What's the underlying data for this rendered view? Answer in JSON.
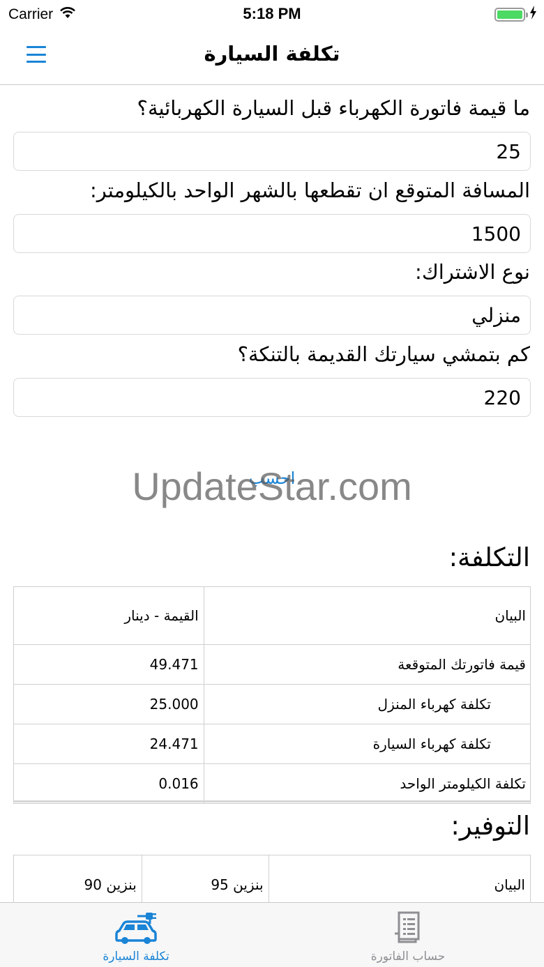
{
  "status_bar": {
    "carrier": "Carrier",
    "time": "5:18 PM",
    "battery_level": 1.0
  },
  "nav": {
    "title": "تكلفة السيارة",
    "menu_icon": "hamburger-menu-icon"
  },
  "form": {
    "q1": {
      "label": "ما قيمة فاتورة الكهرباء قبل السيارة الكهربائية؟",
      "value": "25"
    },
    "q2": {
      "label": "المسافة المتوقع ان تقطعها بالشهر الواحد بالكيلومتر:",
      "value": "1500"
    },
    "q3": {
      "label": "نوع الاشتراك:",
      "value": "منزلي"
    },
    "q4": {
      "label": "كم بتمشي سيارتك القديمة بالتنكة؟",
      "value": "220"
    },
    "calculate_label": "احسب"
  },
  "watermark": "UpdateStar.com",
  "cost": {
    "title": "التكلفة:",
    "header": {
      "label": "البيان",
      "value": "القيمة - دينار"
    },
    "rows": [
      {
        "label": "قيمة فاتورتك المتوقعة",
        "value": "49.471"
      },
      {
        "label": "تكلفة كهرباء المنزل",
        "value": "25.000"
      },
      {
        "label": "تكلفة كهرباء السيارة",
        "value": "24.471"
      },
      {
        "label": "تكلفة الكيلومتر الواحد",
        "value": "0.016"
      }
    ]
  },
  "savings": {
    "title": "التوفير:",
    "header": {
      "label": "البيان",
      "b95": "بنزين 95",
      "b90": "بنزين 90"
    }
  },
  "tabbar": {
    "car": {
      "label": "تكلفة السيارة",
      "icon": "electric-car-icon"
    },
    "bill": {
      "label": "حساب الفاتورة",
      "icon": "receipt-icon"
    }
  },
  "colors": {
    "accent": "#1a84d6",
    "inactive": "#8e8e93",
    "battery": "#4cd964"
  }
}
